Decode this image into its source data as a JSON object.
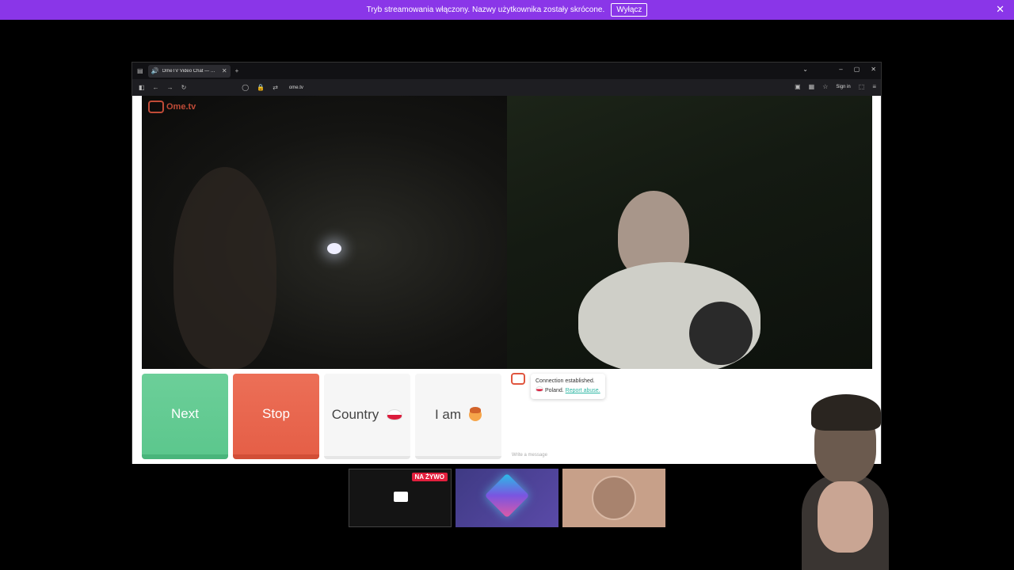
{
  "stream_bar": {
    "message": "Tryb streamowania włączony. Nazwy użytkownika zostały skrócone.",
    "button": "Wyłącz",
    "close": "✕"
  },
  "browser": {
    "tab_title": "OmeTV Video Chat — Ome",
    "new_tab": "+",
    "url": "ome.tv",
    "signin": "Sign in",
    "window_controls": [
      "–",
      "▢",
      "✕"
    ]
  },
  "page": {
    "logo_text": "Ome.tv",
    "buttons": {
      "next": "Next",
      "stop": "Stop",
      "country": "Country",
      "iam": "I am"
    },
    "chat": {
      "status": "Connection established.",
      "country": "Poland.",
      "report": "Report abuse.",
      "placeholder": "Write a message"
    }
  },
  "thumbnails": {
    "live_badge": "NA ŻYWO"
  },
  "colors": {
    "stream_bar": "#8a36e8",
    "next": "#5cc78d",
    "stop": "#e55f47",
    "ome_red": "#e0563f",
    "live": "#e21f3d"
  }
}
